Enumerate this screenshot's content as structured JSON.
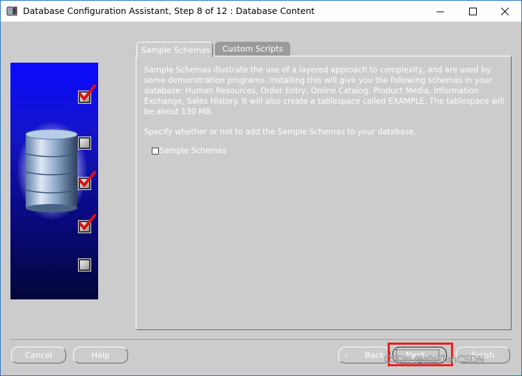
{
  "window": {
    "title": "Database Configuration Assistant, Step 8 of 12 : Database Content",
    "controls": {
      "minimize": "minimize-icon",
      "maximize": "maximize-icon",
      "close": "close-icon"
    }
  },
  "sidebar": {
    "steps": [
      {
        "state": "checked"
      },
      {
        "state": "unchecked"
      },
      {
        "state": "checked"
      },
      {
        "state": "checked"
      },
      {
        "state": "unchecked"
      }
    ]
  },
  "tabs": [
    {
      "label": "Sample Schemas",
      "active": true
    },
    {
      "label": "Custom Scripts",
      "active": false
    }
  ],
  "content": {
    "description": "Sample Schemas illustrate the use of a layered approach to complexity, and are used by some demonstration programs. Installing this will give you the following schemas in your database: Human Resources, Order Entry, Online Catalog, Product Media, Information Exchange, Sales History. It will also create a tablespace called EXAMPLE. The tablespace will be about 130 MB.",
    "prompt": "Specify whether or not to add the Sample Schemas to your database.",
    "checkbox": {
      "label": "Sample Schemas",
      "checked": false
    }
  },
  "buttons": {
    "cancel": "Cancel",
    "help": "Help",
    "back": "Back",
    "next": "Next",
    "finish": "Finish"
  },
  "watermark": "CSDN @xiaTianCSDN",
  "colors": {
    "highlight": "#ee1c1c",
    "background": "#cccccc"
  }
}
